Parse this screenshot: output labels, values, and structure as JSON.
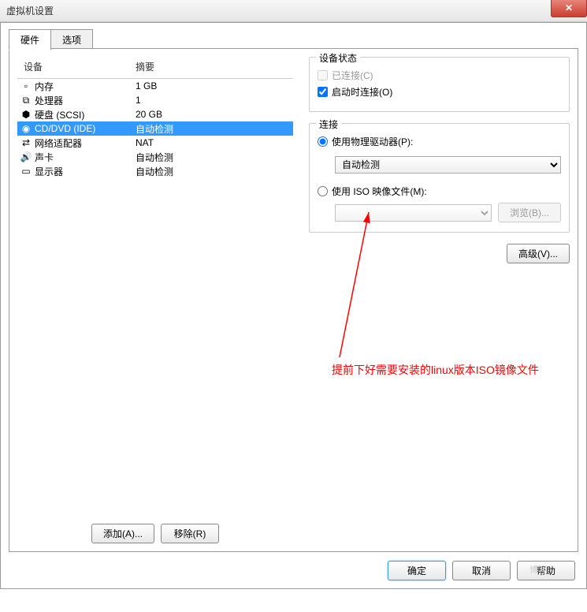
{
  "window": {
    "title": "虚拟机设置",
    "close": "✕"
  },
  "tabs": {
    "hardware": "硬件",
    "options": "选项"
  },
  "list": {
    "header_device": "设备",
    "header_summary": "摘要",
    "rows": [
      {
        "name": "内存",
        "summary": "1 GB"
      },
      {
        "name": "处理器",
        "summary": "1"
      },
      {
        "name": "硬盘 (SCSI)",
        "summary": "20 GB"
      },
      {
        "name": "CD/DVD (IDE)",
        "summary": "自动检测"
      },
      {
        "name": "网络适配器",
        "summary": "NAT"
      },
      {
        "name": "声卡",
        "summary": "自动检测"
      },
      {
        "name": "显示器",
        "summary": "自动检测"
      }
    ],
    "add": "添加(A)...",
    "remove": "移除(R)"
  },
  "status": {
    "group": "设备状态",
    "connected": "已连接(C)",
    "connect_power": "启动时连接(O)"
  },
  "conn": {
    "group": "连接",
    "physical": "使用物理驱动器(P):",
    "auto": "自动检测",
    "iso": "使用 ISO 映像文件(M):",
    "browse": "浏览(B)...",
    "advanced": "高级(V)..."
  },
  "footer": {
    "ok": "确定",
    "cancel": "取消",
    "help": "帮助"
  },
  "annotation": "提前下好需要安装的linux版本ISO镜像文件",
  "watermark": "博客"
}
